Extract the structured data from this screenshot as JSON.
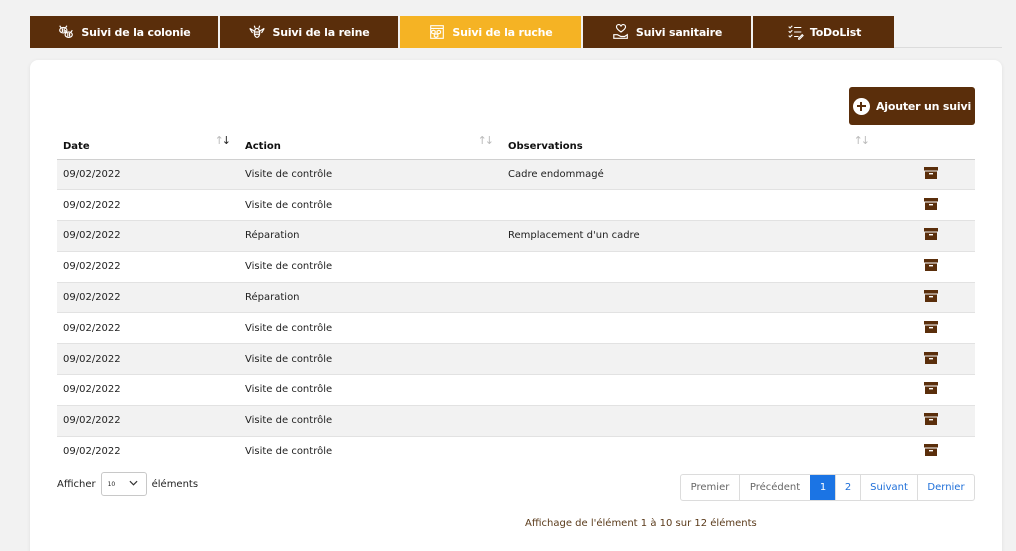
{
  "tabs": [
    {
      "label": "Suivi de la colonie",
      "icon": "bees-icon",
      "active": false
    },
    {
      "label": "Suivi de la reine",
      "icon": "queen-bee-icon",
      "active": false
    },
    {
      "label": "Suivi de la ruche",
      "icon": "hive-frame-icon",
      "active": true
    },
    {
      "label": "Suivi sanitaire",
      "icon": "heart-hand-icon",
      "active": false
    },
    {
      "label": "ToDoList",
      "icon": "checklist-icon",
      "active": false
    }
  ],
  "toolbar": {
    "add_label": "Ajouter un suivi"
  },
  "table": {
    "columns": [
      "Date",
      "Action",
      "Observations"
    ],
    "rows": [
      {
        "date": "09/02/2022",
        "action": "Visite de contrôle",
        "observations": "Cadre endommagé"
      },
      {
        "date": "09/02/2022",
        "action": "Visite de contrôle",
        "observations": ""
      },
      {
        "date": "09/02/2022",
        "action": "Réparation",
        "observations": "Remplacement d'un cadre"
      },
      {
        "date": "09/02/2022",
        "action": "Visite de contrôle",
        "observations": ""
      },
      {
        "date": "09/02/2022",
        "action": "Réparation",
        "observations": ""
      },
      {
        "date": "09/02/2022",
        "action": "Visite de contrôle",
        "observations": ""
      },
      {
        "date": "09/02/2022",
        "action": "Visite de contrôle",
        "observations": ""
      },
      {
        "date": "09/02/2022",
        "action": "Visite de contrôle",
        "observations": ""
      },
      {
        "date": "09/02/2022",
        "action": "Visite de contrôle",
        "observations": ""
      },
      {
        "date": "09/02/2022",
        "action": "Visite de contrôle",
        "observations": ""
      }
    ]
  },
  "length": {
    "prefix": "Afficher",
    "value": "10",
    "suffix": "éléments"
  },
  "pagination": {
    "first": "Premier",
    "previous": "Précédent",
    "pages": [
      "1",
      "2"
    ],
    "current": "1",
    "next": "Suivant",
    "last": "Dernier"
  },
  "info": "Affichage de l'élément 1 à 10 sur 12 éléments",
  "colors": {
    "brown": "#5a2e0b",
    "amber": "#f5b324",
    "blue": "#1b74e4"
  }
}
